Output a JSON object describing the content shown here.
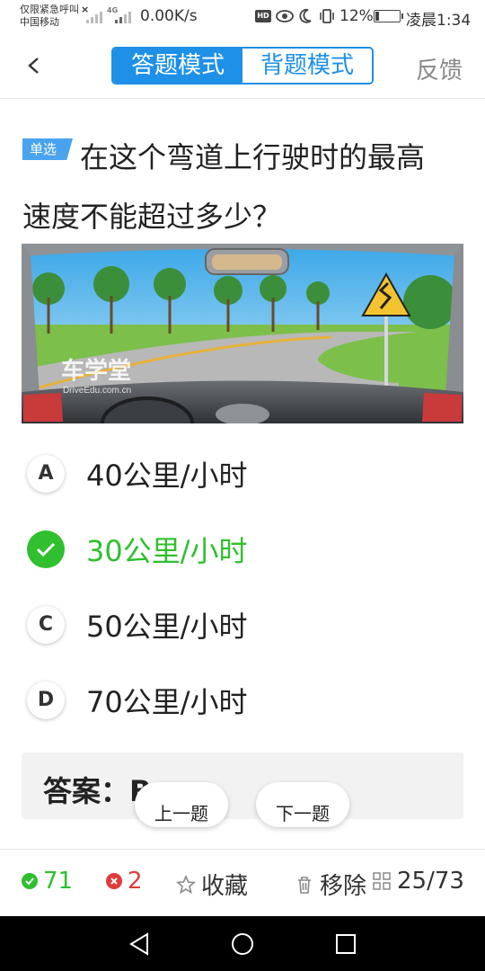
{
  "status_bar": {
    "carrier_line1": "仅限紧急呼叫",
    "carrier_line2": "中国移动",
    "network": "4G",
    "speed": "0.00K/s",
    "hd": "HD",
    "battery": "12%",
    "time": "凌晨1:34"
  },
  "header": {
    "tabs": [
      {
        "label": "答题模式",
        "active": true
      },
      {
        "label": "背题模式",
        "active": false
      }
    ],
    "feedback_label": "反馈"
  },
  "question": {
    "type_tag": "单选",
    "text": "在这个弯道上行驶时的最高速度不能超过多少？",
    "image_watermark": "车学堂",
    "image_watermark_sub": "DriveEdu.com.cn"
  },
  "options": [
    {
      "letter": "A",
      "text": "40公里/小时",
      "correct": false
    },
    {
      "letter": "B",
      "text": "30公里/小时",
      "correct": true
    },
    {
      "letter": "C",
      "text": "50公里/小时",
      "correct": false
    },
    {
      "letter": "D",
      "text": "70公里/小时",
      "correct": false
    }
  ],
  "answer": {
    "label": "答案：B"
  },
  "navigation": {
    "prev_label": "上一题",
    "next_label": "下一题"
  },
  "bottom_bar": {
    "correct_count": "71",
    "wrong_count": "2",
    "favorite_label": "收藏",
    "remove_label": "移除",
    "progress": "25/73"
  },
  "colors": {
    "accent": "#1e90e8",
    "correct": "#2fbf2f",
    "wrong": "#e23a3a"
  }
}
